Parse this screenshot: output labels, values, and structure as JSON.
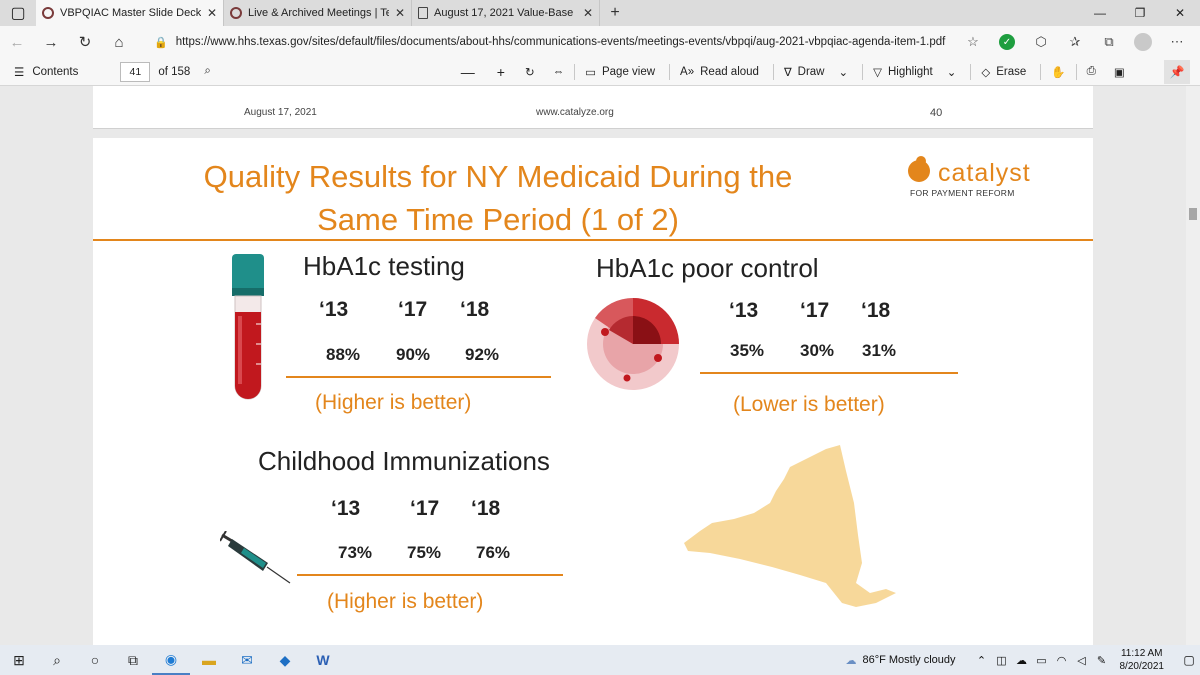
{
  "browser": {
    "tabs": [
      {
        "title": "VBPQIAC Master Slide Deck_AUG",
        "active": true
      },
      {
        "title": "Live & Archived Meetings | Texas",
        "active": false
      },
      {
        "title": "August 17, 2021 Value-Base",
        "active": false
      }
    ],
    "url": "https://www.hhs.texas.gov/sites/default/files/documents/about-hhs/communications-events/meetings-events/vbpqi/aug-2021-vbpqiac-agenda-item-1.pdf"
  },
  "pdf_toolbar": {
    "contents_label": "Contents",
    "page_current": "41",
    "page_total": "of 158",
    "page_view_label": "Page view",
    "read_aloud_label": "Read aloud",
    "draw_label": "Draw",
    "highlight_label": "Highlight",
    "erase_label": "Erase"
  },
  "prev_page_footer": {
    "date": "August 17, 2021",
    "url": "www.catalyze.org",
    "page_number": "40"
  },
  "slide": {
    "title_line1": "Quality Results for NY Medicaid During the",
    "title_line2": "Same Time Period (1 of 2)",
    "logo_word": "catalyst",
    "logo_sub": "FOR PAYMENT REFORM",
    "accent_color": "#e3861c",
    "sections": [
      {
        "heading": "HbA1c testing",
        "years": [
          "‘13",
          "‘17",
          "‘18"
        ],
        "values": [
          "88%",
          "90%",
          "92%"
        ],
        "note": "(Higher is better)",
        "icon": "blood-tube-icon"
      },
      {
        "heading": "HbA1c poor control",
        "years": [
          "‘13",
          "‘17",
          "‘18"
        ],
        "values": [
          "35%",
          "30%",
          "31%"
        ],
        "note": "(Lower is better)",
        "icon": "blood-cell-icon"
      },
      {
        "heading": "Childhood Immunizations",
        "years": [
          "‘13",
          "‘17",
          "‘18"
        ],
        "values": [
          "73%",
          "75%",
          "76%"
        ],
        "note": "(Higher is better)",
        "icon": "syringe-icon"
      }
    ],
    "map_icon": "new-york-state-map-icon"
  },
  "taskbar": {
    "weather": "86°F  Mostly cloudy",
    "time": "11:12 AM",
    "date": "8/20/2021"
  }
}
